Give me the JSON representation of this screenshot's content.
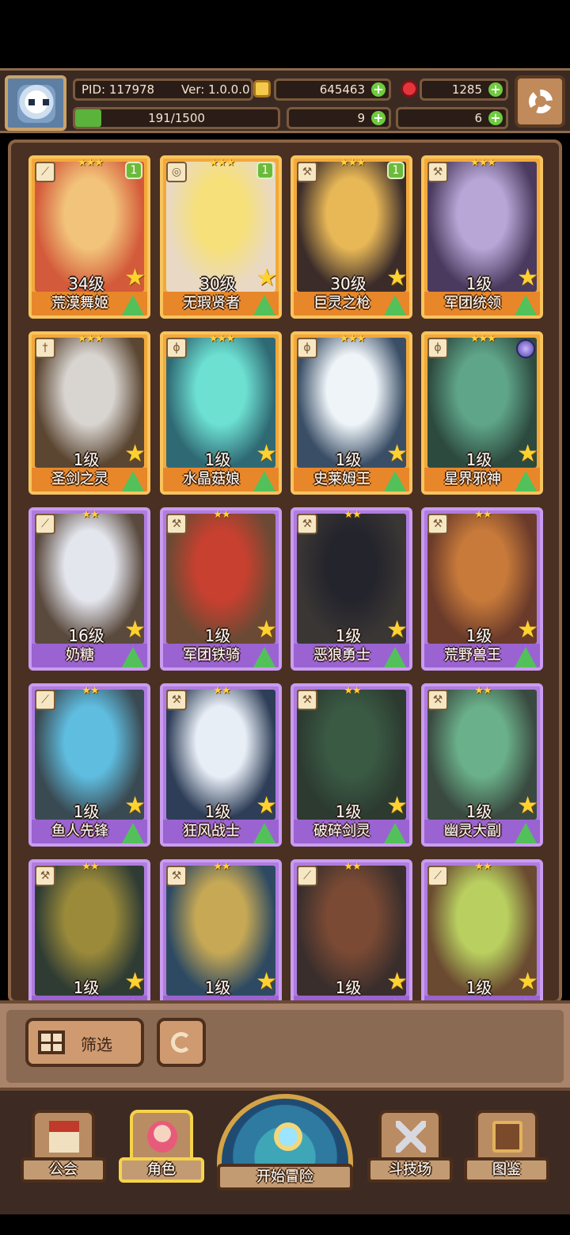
{
  "topbar": {
    "pid": "PID: 117978",
    "version": "Ver: 1.0.0.0",
    "gold": "645463",
    "gems": "1285",
    "exp": "191/1500",
    "exp_fraction": 0.127,
    "clover": "9",
    "tickets": "6"
  },
  "cards": [
    {
      "name": "荒漠舞姬",
      "level": "34级",
      "rarity": 3,
      "badge": "1",
      "class_icon": "bow-icon",
      "colors": [
        "#d35a3a",
        "#f2c37a"
      ]
    },
    {
      "name": "无瑕贤者",
      "level": "30级",
      "rarity": 3,
      "badge": "1",
      "class_icon": "orb-icon",
      "colors": [
        "#e9d9c4",
        "#f6e07a"
      ]
    },
    {
      "name": "巨灵之枪",
      "level": "30级",
      "rarity": 3,
      "badge": "1",
      "class_icon": "axe-icon",
      "colors": [
        "#3b2c2a",
        "#e8b857"
      ]
    },
    {
      "name": "军团统领",
      "level": "1级",
      "rarity": 3,
      "badge": "",
      "class_icon": "axe-icon",
      "colors": [
        "#4a3a5e",
        "#b7a6d6"
      ]
    },
    {
      "name": "圣剑之灵",
      "level": "1级",
      "rarity": 3,
      "badge": "",
      "class_icon": "sword-icon",
      "colors": [
        "#5b4632",
        "#d8d4d0"
      ]
    },
    {
      "name": "水晶菇娘",
      "level": "1级",
      "rarity": 3,
      "badge": "",
      "class_icon": "staff-icon",
      "colors": [
        "#2f6a74",
        "#6de0d2"
      ]
    },
    {
      "name": "史莱姆王",
      "level": "1级",
      "rarity": 3,
      "badge": "",
      "class_icon": "staff-icon",
      "colors": [
        "#3a4e66",
        "#eef4f8"
      ]
    },
    {
      "name": "星界邪神",
      "level": "1级",
      "rarity": 3,
      "badge": "",
      "class_icon": "staff-icon",
      "colors": [
        "#2d4a3e",
        "#5fa58a"
      ]
    },
    {
      "name": "奶糖",
      "level": "16级",
      "rarity": 2,
      "badge": "",
      "class_icon": "bow-icon",
      "colors": [
        "#5a4a3e",
        "#e4e6ee"
      ]
    },
    {
      "name": "军团铁骑",
      "level": "1级",
      "rarity": 2,
      "badge": "",
      "class_icon": "axe-icon",
      "colors": [
        "#6a4a34",
        "#c8402f"
      ]
    },
    {
      "name": "恶狼勇士",
      "level": "1级",
      "rarity": 2,
      "badge": "",
      "class_icon": "axe-icon",
      "colors": [
        "#3a3634",
        "#24242c"
      ]
    },
    {
      "name": "荒野兽王",
      "level": "1级",
      "rarity": 2,
      "badge": "",
      "class_icon": "axe-icon",
      "colors": [
        "#6a3a2a",
        "#c77a3a"
      ]
    },
    {
      "name": "鱼人先锋",
      "level": "1级",
      "rarity": 2,
      "badge": "",
      "class_icon": "bow-icon",
      "colors": [
        "#3a4a52",
        "#5fbde0"
      ]
    },
    {
      "name": "狂风战士",
      "level": "1级",
      "rarity": 2,
      "badge": "",
      "class_icon": "axe-icon",
      "colors": [
        "#2e3e58",
        "#e8eef6"
      ]
    },
    {
      "name": "破碎剑灵",
      "level": "1级",
      "rarity": 2,
      "badge": "",
      "class_icon": "axe-icon",
      "colors": [
        "#2c3a30",
        "#3a5a44"
      ]
    },
    {
      "name": "幽灵大副",
      "level": "1级",
      "rarity": 2,
      "badge": "",
      "class_icon": "axe-icon",
      "colors": [
        "#3a4a40",
        "#6ab08a"
      ]
    },
    {
      "name": "",
      "level": "1级",
      "rarity": 2,
      "badge": "",
      "class_icon": "axe-icon",
      "colors": [
        "#2f3c34",
        "#9a8a3a"
      ]
    },
    {
      "name": "",
      "level": "1级",
      "rarity": 2,
      "badge": "",
      "class_icon": "axe-icon",
      "colors": [
        "#2e4a62",
        "#c7a955"
      ]
    },
    {
      "name": "",
      "level": "1级",
      "rarity": 2,
      "badge": "",
      "class_icon": "bow-icon",
      "colors": [
        "#3a2e2c",
        "#7a4a34"
      ]
    },
    {
      "name": "",
      "level": "1级",
      "rarity": 2,
      "badge": "",
      "class_icon": "bow-icon",
      "colors": [
        "#6a4a30",
        "#b9d060"
      ]
    }
  ],
  "filter": {
    "label": "筛选"
  },
  "nav": {
    "guild": "公会",
    "characters": "角色",
    "adventure": "开始冒险",
    "arena": "斗技场",
    "codex": "图鉴"
  }
}
